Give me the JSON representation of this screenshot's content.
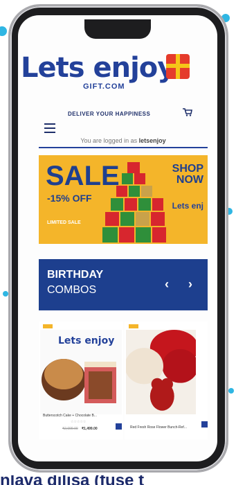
{
  "header": {
    "logo_text": "Lets enjoy",
    "logo_sub": "GIFT.COM",
    "tagline": "DELIVER YOUR HAPPINESS",
    "login_prefix": "You are logged in as",
    "login_user": "letsenjoy"
  },
  "banner": {
    "title": "SALE",
    "discount": "-15% OFF",
    "limited": "LIMITED SALE",
    "shop_line1": "SHOP",
    "shop_line2": "NOW",
    "brand": "Lets enj"
  },
  "section": {
    "title": "BIRTHDAY",
    "subtitle": "COMBOS",
    "prev": "‹",
    "next": "›"
  },
  "products": [
    {
      "name": "Butterscotch Cake + Chocolate B...",
      "stars": "☆☆☆☆☆",
      "old_price": "₹2,099.00",
      "price": "₹1,499.00",
      "brand": "Lets enjoy"
    },
    {
      "name": "Red Fresh Rose Flower Bunch-Ref..."
    }
  ],
  "colors": {
    "brand_blue": "#23419a",
    "banner_yellow": "#f4b52a",
    "combos_blue": "#1d3f8e"
  },
  "footer_fragment": "nlava dilisa (fuse t"
}
